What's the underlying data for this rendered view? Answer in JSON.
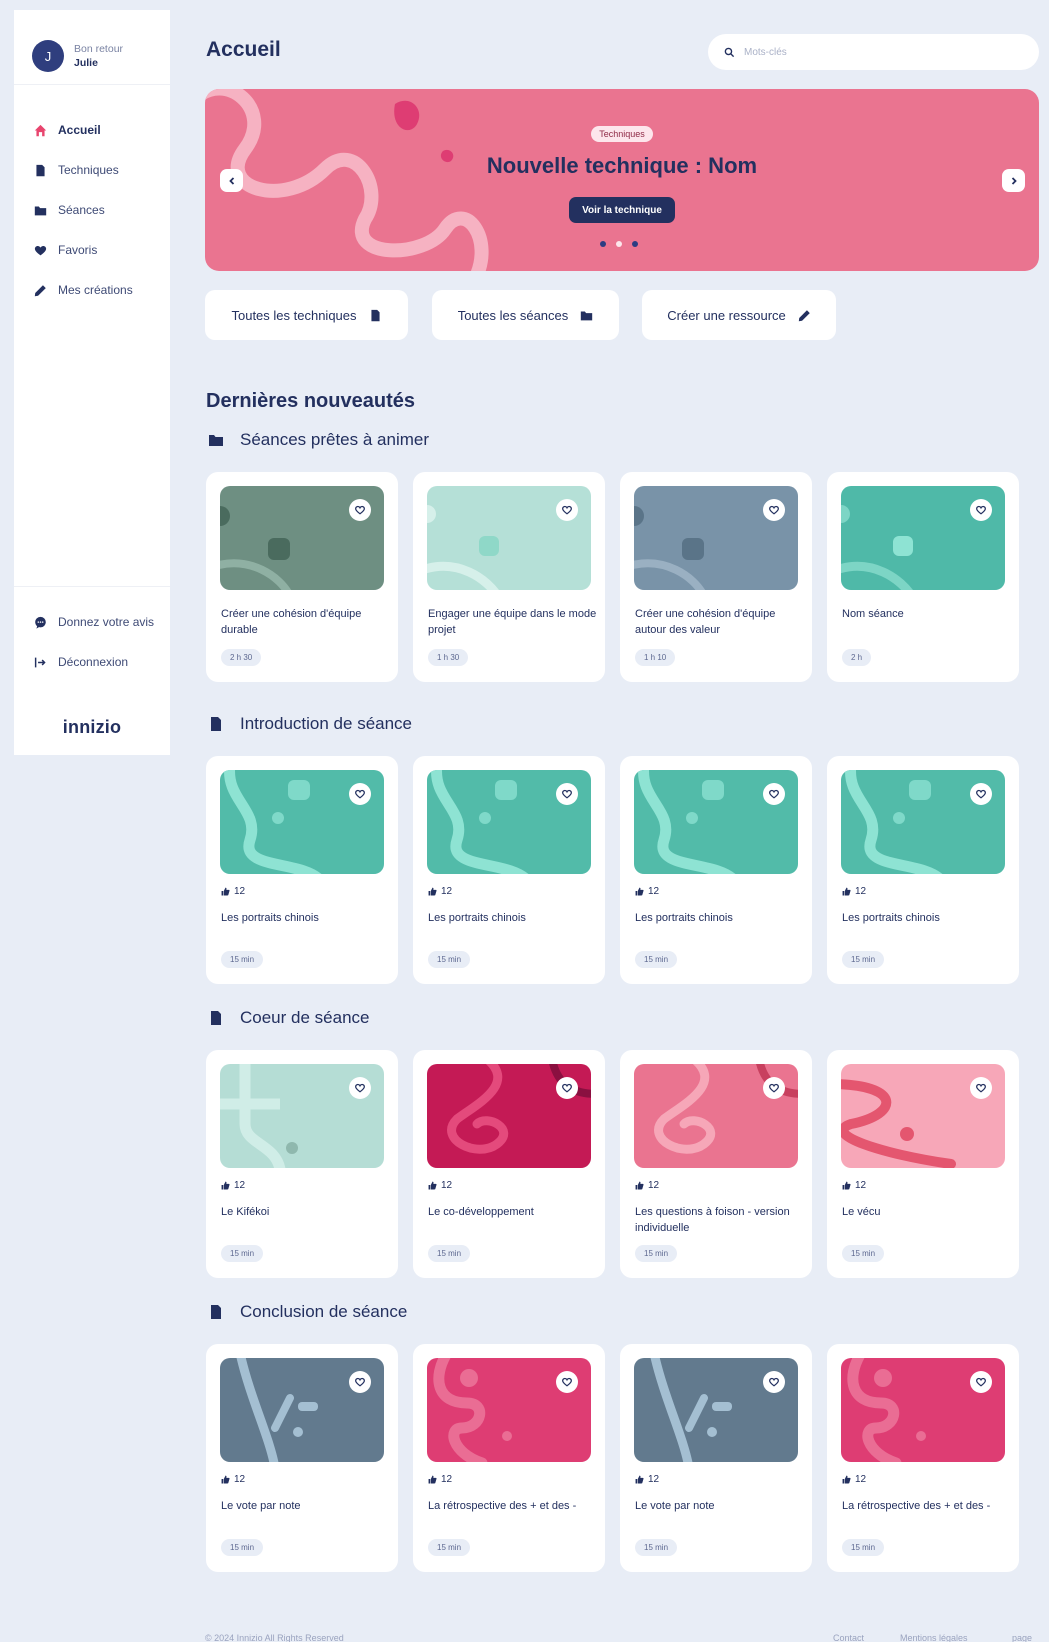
{
  "user": {
    "initial": "J",
    "greeting": "Bon retour",
    "name": "Julie"
  },
  "nav": [
    {
      "label": "Accueil",
      "icon": "home-icon"
    },
    {
      "label": "Techniques",
      "icon": "document-icon"
    },
    {
      "label": "Séances",
      "icon": "folder-icon"
    },
    {
      "label": "Favoris",
      "icon": "heart-icon"
    },
    {
      "label": "Mes créations",
      "icon": "pencil-icon"
    }
  ],
  "nav_bottom": [
    {
      "label": "Donnez votre avis",
      "icon": "chat-icon"
    },
    {
      "label": "Déconnexion",
      "icon": "logout-icon"
    }
  ],
  "logo": "innizio",
  "header": {
    "title": "Accueil",
    "search_placeholder": "Mots-clés"
  },
  "hero": {
    "badge": "Techniques",
    "title": "Nouvelle technique : Nom",
    "button": "Voir la technique",
    "active_dot": 2
  },
  "quick_actions": [
    {
      "label": "Toutes les techniques",
      "icon": "document-icon"
    },
    {
      "label": "Toutes les séances",
      "icon": "folder-icon"
    },
    {
      "label": "Créer une ressource",
      "icon": "pencil-icon"
    }
  ],
  "latest_title": "Dernières nouveautés",
  "sections": [
    {
      "title": "Séances prêtes à animer",
      "icon": "folder-icon",
      "cards": [
        {
          "title": "Créer une cohésion d'équipe durable",
          "duration": "2 h 30"
        },
        {
          "title": "Engager une équipe dans le mode projet",
          "duration": "1 h 30"
        },
        {
          "title": "Créer une cohésion d'équipe autour des valeur",
          "duration": "1 h 10"
        },
        {
          "title": "Nom séance",
          "duration": "2 h"
        }
      ]
    },
    {
      "title": "Introduction de séance",
      "icon": "document-icon",
      "cards": [
        {
          "likes": "12",
          "title": "Les portraits chinois",
          "duration": "15 min"
        },
        {
          "likes": "12",
          "title": "Les portraits chinois",
          "duration": "15 min"
        },
        {
          "likes": "12",
          "title": "Les portraits chinois",
          "duration": "15 min"
        },
        {
          "likes": "12",
          "title": "Les portraits chinois",
          "duration": "15 min"
        }
      ]
    },
    {
      "title": "Coeur de séance",
      "icon": "document-icon",
      "cards": [
        {
          "likes": "12",
          "title": "Le Kifékoi",
          "duration": "15 min"
        },
        {
          "likes": "12",
          "title": "Le co-développement",
          "duration": "15 min"
        },
        {
          "likes": "12",
          "title": "Les questions à foison - version individuelle",
          "duration": "15 min"
        },
        {
          "likes": "12",
          "title": "Le vécu",
          "duration": "15 min"
        }
      ]
    },
    {
      "title": "Conclusion de séance",
      "icon": "document-icon",
      "cards": [
        {
          "likes": "12",
          "title": "Le vote par note",
          "duration": "15 min"
        },
        {
          "likes": "12",
          "title": "La rétrospective des + et des -",
          "duration": "15 min"
        },
        {
          "likes": "12",
          "title": "Le vote par note",
          "duration": "15 min"
        },
        {
          "likes": "12",
          "title": "La rétrospective des + et des -",
          "duration": "15 min"
        }
      ]
    }
  ],
  "colors": {
    "navy": "#23305f",
    "background": "#e8edf6",
    "hero": "#ea7490",
    "thumb_palettes": [
      [
        "#6e8f82",
        "#4a6b5e",
        "#8fb0a3"
      ],
      [
        "#b5e0d7",
        "#8fd8c8",
        "#d6f0ea"
      ],
      [
        "#7993a8",
        "#5a7488",
        "#9ab0c2"
      ],
      [
        "#4fb9a8",
        "#8ee3d3",
        "#7dd5c5"
      ],
      [
        "#52bba9",
        "#8ee3d3",
        "#7fd9c9"
      ],
      [
        "#b5ddd5",
        "#d0ede7",
        "#8fb8ae"
      ],
      [
        "#c41a55",
        "#8a1040",
        "#e44a7c"
      ],
      [
        "#ea7490",
        "#c8405f",
        "#f6a7b8"
      ],
      [
        "#f7a7b8",
        "#f9c6d1",
        "#e4566f"
      ],
      [
        "#627a8e",
        "#8aaac2",
        "#a4bfd2"
      ],
      [
        "#de3d73",
        "#f28aa8",
        "#ea6d94"
      ]
    ]
  },
  "footer": {
    "copyright": "© 2024 Innizio All Rights Reserved",
    "links": [
      "Contact",
      "Mentions légales",
      "page légale"
    ]
  }
}
